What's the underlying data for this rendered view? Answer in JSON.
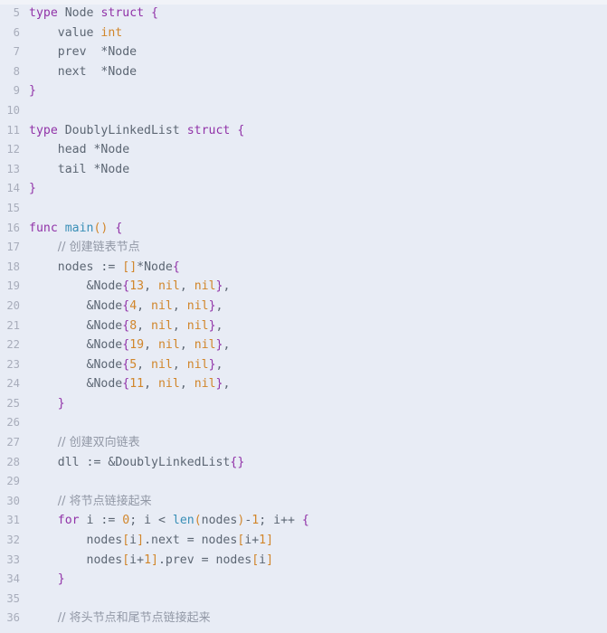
{
  "editor": {
    "language": "go",
    "background_color": "#e8ecf5",
    "gutter_color": "#a8adbb",
    "default_text_color": "#5c6673",
    "first_visible_line": 5,
    "last_visible_line": 36,
    "theme_colors": {
      "keyword": "#9133a8",
      "type": "#d1862b",
      "number": "#d1862b",
      "function": "#3a8fb7",
      "identifier": "#5c6673",
      "comment": "#9298a6",
      "punctuation": "#9133a8",
      "bracket": "#d1862b"
    }
  },
  "lines": [
    {
      "n": "5",
      "tokens": [
        {
          "t": "type",
          "c": "kw"
        },
        {
          "t": " ",
          "c": "plain"
        },
        {
          "t": "Node",
          "c": "id"
        },
        {
          "t": " ",
          "c": "plain"
        },
        {
          "t": "struct",
          "c": "kw"
        },
        {
          "t": " ",
          "c": "plain"
        },
        {
          "t": "{",
          "c": "pun"
        }
      ]
    },
    {
      "n": "6",
      "tokens": [
        {
          "t": "    value ",
          "c": "plain"
        },
        {
          "t": "int",
          "c": "type"
        }
      ]
    },
    {
      "n": "7",
      "tokens": [
        {
          "t": "    prev  ",
          "c": "plain"
        },
        {
          "t": "*",
          "c": "op"
        },
        {
          "t": "Node",
          "c": "id"
        }
      ]
    },
    {
      "n": "8",
      "tokens": [
        {
          "t": "    next  ",
          "c": "plain"
        },
        {
          "t": "*",
          "c": "op"
        },
        {
          "t": "Node",
          "c": "id"
        }
      ]
    },
    {
      "n": "9",
      "tokens": [
        {
          "t": "}",
          "c": "pun"
        }
      ]
    },
    {
      "n": "10",
      "tokens": []
    },
    {
      "n": "11",
      "tokens": [
        {
          "t": "type",
          "c": "kw"
        },
        {
          "t": " ",
          "c": "plain"
        },
        {
          "t": "DoublyLinkedList",
          "c": "id"
        },
        {
          "t": " ",
          "c": "plain"
        },
        {
          "t": "struct",
          "c": "kw"
        },
        {
          "t": " ",
          "c": "plain"
        },
        {
          "t": "{",
          "c": "pun"
        }
      ]
    },
    {
      "n": "12",
      "tokens": [
        {
          "t": "    head ",
          "c": "plain"
        },
        {
          "t": "*",
          "c": "op"
        },
        {
          "t": "Node",
          "c": "id"
        }
      ]
    },
    {
      "n": "13",
      "tokens": [
        {
          "t": "    tail ",
          "c": "plain"
        },
        {
          "t": "*",
          "c": "op"
        },
        {
          "t": "Node",
          "c": "id"
        }
      ]
    },
    {
      "n": "14",
      "tokens": [
        {
          "t": "}",
          "c": "pun"
        }
      ]
    },
    {
      "n": "15",
      "tokens": []
    },
    {
      "n": "16",
      "tokens": [
        {
          "t": "func",
          "c": "kw"
        },
        {
          "t": " ",
          "c": "plain"
        },
        {
          "t": "main",
          "c": "fn"
        },
        {
          "t": "()",
          "c": "brk"
        },
        {
          "t": " ",
          "c": "plain"
        },
        {
          "t": "{",
          "c": "pun"
        }
      ]
    },
    {
      "n": "17",
      "tokens": [
        {
          "t": "    ",
          "c": "plain"
        },
        {
          "t": "// 创建链表节点",
          "c": "cmt"
        }
      ]
    },
    {
      "n": "18",
      "tokens": [
        {
          "t": "    nodes ",
          "c": "plain"
        },
        {
          "t": ":=",
          "c": "op"
        },
        {
          "t": " ",
          "c": "plain"
        },
        {
          "t": "[]",
          "c": "brk"
        },
        {
          "t": "*",
          "c": "op"
        },
        {
          "t": "Node",
          "c": "id"
        },
        {
          "t": "{",
          "c": "pun"
        }
      ]
    },
    {
      "n": "19",
      "tokens": [
        {
          "t": "        ",
          "c": "plain"
        },
        {
          "t": "&",
          "c": "op"
        },
        {
          "t": "Node",
          "c": "id"
        },
        {
          "t": "{",
          "c": "pun"
        },
        {
          "t": "13",
          "c": "num"
        },
        {
          "t": ", ",
          "c": "plain"
        },
        {
          "t": "nil",
          "c": "nil"
        },
        {
          "t": ", ",
          "c": "plain"
        },
        {
          "t": "nil",
          "c": "nil"
        },
        {
          "t": "}",
          "c": "pun"
        },
        {
          "t": ",",
          "c": "plain"
        }
      ]
    },
    {
      "n": "20",
      "tokens": [
        {
          "t": "        ",
          "c": "plain"
        },
        {
          "t": "&",
          "c": "op"
        },
        {
          "t": "Node",
          "c": "id"
        },
        {
          "t": "{",
          "c": "pun"
        },
        {
          "t": "4",
          "c": "num"
        },
        {
          "t": ", ",
          "c": "plain"
        },
        {
          "t": "nil",
          "c": "nil"
        },
        {
          "t": ", ",
          "c": "plain"
        },
        {
          "t": "nil",
          "c": "nil"
        },
        {
          "t": "}",
          "c": "pun"
        },
        {
          "t": ",",
          "c": "plain"
        }
      ]
    },
    {
      "n": "21",
      "tokens": [
        {
          "t": "        ",
          "c": "plain"
        },
        {
          "t": "&",
          "c": "op"
        },
        {
          "t": "Node",
          "c": "id"
        },
        {
          "t": "{",
          "c": "pun"
        },
        {
          "t": "8",
          "c": "num"
        },
        {
          "t": ", ",
          "c": "plain"
        },
        {
          "t": "nil",
          "c": "nil"
        },
        {
          "t": ", ",
          "c": "plain"
        },
        {
          "t": "nil",
          "c": "nil"
        },
        {
          "t": "}",
          "c": "pun"
        },
        {
          "t": ",",
          "c": "plain"
        }
      ]
    },
    {
      "n": "22",
      "tokens": [
        {
          "t": "        ",
          "c": "plain"
        },
        {
          "t": "&",
          "c": "op"
        },
        {
          "t": "Node",
          "c": "id"
        },
        {
          "t": "{",
          "c": "pun"
        },
        {
          "t": "19",
          "c": "num"
        },
        {
          "t": ", ",
          "c": "plain"
        },
        {
          "t": "nil",
          "c": "nil"
        },
        {
          "t": ", ",
          "c": "plain"
        },
        {
          "t": "nil",
          "c": "nil"
        },
        {
          "t": "}",
          "c": "pun"
        },
        {
          "t": ",",
          "c": "plain"
        }
      ]
    },
    {
      "n": "23",
      "tokens": [
        {
          "t": "        ",
          "c": "plain"
        },
        {
          "t": "&",
          "c": "op"
        },
        {
          "t": "Node",
          "c": "id"
        },
        {
          "t": "{",
          "c": "pun"
        },
        {
          "t": "5",
          "c": "num"
        },
        {
          "t": ", ",
          "c": "plain"
        },
        {
          "t": "nil",
          "c": "nil"
        },
        {
          "t": ", ",
          "c": "plain"
        },
        {
          "t": "nil",
          "c": "nil"
        },
        {
          "t": "}",
          "c": "pun"
        },
        {
          "t": ",",
          "c": "plain"
        }
      ]
    },
    {
      "n": "24",
      "tokens": [
        {
          "t": "        ",
          "c": "plain"
        },
        {
          "t": "&",
          "c": "op"
        },
        {
          "t": "Node",
          "c": "id"
        },
        {
          "t": "{",
          "c": "pun"
        },
        {
          "t": "11",
          "c": "num"
        },
        {
          "t": ", ",
          "c": "plain"
        },
        {
          "t": "nil",
          "c": "nil"
        },
        {
          "t": ", ",
          "c": "plain"
        },
        {
          "t": "nil",
          "c": "nil"
        },
        {
          "t": "}",
          "c": "pun"
        },
        {
          "t": ",",
          "c": "plain"
        }
      ]
    },
    {
      "n": "25",
      "tokens": [
        {
          "t": "    ",
          "c": "plain"
        },
        {
          "t": "}",
          "c": "pun"
        }
      ]
    },
    {
      "n": "26",
      "tokens": []
    },
    {
      "n": "27",
      "tokens": [
        {
          "t": "    ",
          "c": "plain"
        },
        {
          "t": "// 创建双向链表",
          "c": "cmt"
        }
      ]
    },
    {
      "n": "28",
      "tokens": [
        {
          "t": "    dll ",
          "c": "plain"
        },
        {
          "t": ":=",
          "c": "op"
        },
        {
          "t": " ",
          "c": "plain"
        },
        {
          "t": "&",
          "c": "op"
        },
        {
          "t": "DoublyLinkedList",
          "c": "id"
        },
        {
          "t": "{}",
          "c": "pun"
        }
      ]
    },
    {
      "n": "29",
      "tokens": []
    },
    {
      "n": "30",
      "tokens": [
        {
          "t": "    ",
          "c": "plain"
        },
        {
          "t": "// 将节点链接起来",
          "c": "cmt"
        }
      ]
    },
    {
      "n": "31",
      "tokens": [
        {
          "t": "    ",
          "c": "plain"
        },
        {
          "t": "for",
          "c": "kw"
        },
        {
          "t": " i ",
          "c": "plain"
        },
        {
          "t": ":=",
          "c": "op"
        },
        {
          "t": " ",
          "c": "plain"
        },
        {
          "t": "0",
          "c": "num"
        },
        {
          "t": "; i ",
          "c": "plain"
        },
        {
          "t": "<",
          "c": "op"
        },
        {
          "t": " ",
          "c": "plain"
        },
        {
          "t": "len",
          "c": "fn"
        },
        {
          "t": "(",
          "c": "brk"
        },
        {
          "t": "nodes",
          "c": "plain"
        },
        {
          "t": ")",
          "c": "brk"
        },
        {
          "t": "-",
          "c": "op"
        },
        {
          "t": "1",
          "c": "num"
        },
        {
          "t": "; i",
          "c": "plain"
        },
        {
          "t": "++",
          "c": "op"
        },
        {
          "t": " ",
          "c": "plain"
        },
        {
          "t": "{",
          "c": "pun"
        }
      ]
    },
    {
      "n": "32",
      "tokens": [
        {
          "t": "        nodes",
          "c": "plain"
        },
        {
          "t": "[",
          "c": "brk"
        },
        {
          "t": "i",
          "c": "plain"
        },
        {
          "t": "]",
          "c": "brk"
        },
        {
          "t": ".next ",
          "c": "plain"
        },
        {
          "t": "=",
          "c": "op"
        },
        {
          "t": " nodes",
          "c": "plain"
        },
        {
          "t": "[",
          "c": "brk"
        },
        {
          "t": "i",
          "c": "plain"
        },
        {
          "t": "+",
          "c": "op"
        },
        {
          "t": "1",
          "c": "num"
        },
        {
          "t": "]",
          "c": "brk"
        }
      ]
    },
    {
      "n": "33",
      "tokens": [
        {
          "t": "        nodes",
          "c": "plain"
        },
        {
          "t": "[",
          "c": "brk"
        },
        {
          "t": "i",
          "c": "plain"
        },
        {
          "t": "+",
          "c": "op"
        },
        {
          "t": "1",
          "c": "num"
        },
        {
          "t": "]",
          "c": "brk"
        },
        {
          "t": ".prev ",
          "c": "plain"
        },
        {
          "t": "=",
          "c": "op"
        },
        {
          "t": " nodes",
          "c": "plain"
        },
        {
          "t": "[",
          "c": "brk"
        },
        {
          "t": "i",
          "c": "plain"
        },
        {
          "t": "]",
          "c": "brk"
        }
      ]
    },
    {
      "n": "34",
      "tokens": [
        {
          "t": "    ",
          "c": "plain"
        },
        {
          "t": "}",
          "c": "pun"
        }
      ]
    },
    {
      "n": "35",
      "tokens": []
    },
    {
      "n": "36",
      "tokens": [
        {
          "t": "    ",
          "c": "plain"
        },
        {
          "t": "// 将头节点和尾节点链接起来",
          "c": "cmt"
        }
      ]
    }
  ]
}
